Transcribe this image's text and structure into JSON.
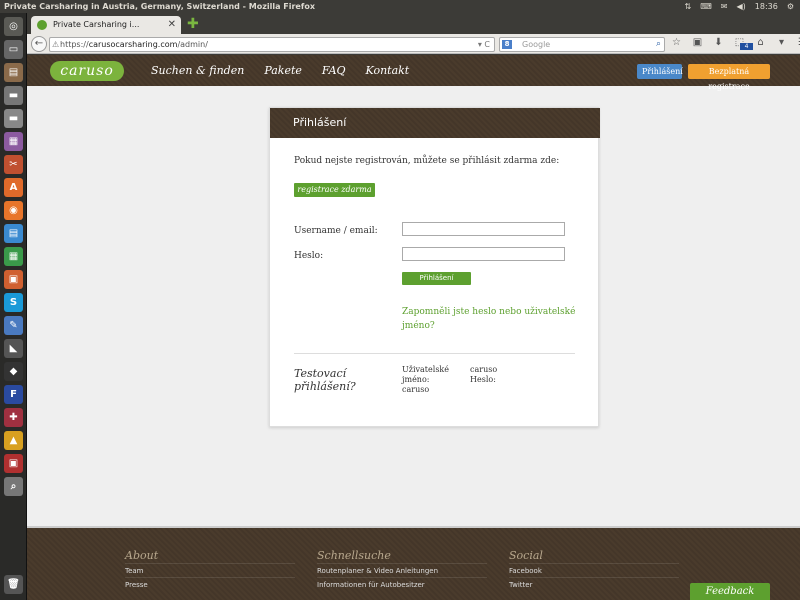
{
  "os": {
    "window_title": "Private Carsharing in Austria, Germany, Switzerland - Mozilla Firefox",
    "clock": "18:36"
  },
  "browser": {
    "tab_title": "Private Carsharing i...",
    "url_host": "carusocarsharing.com",
    "url_scheme": "https://",
    "url_path": "/admin/",
    "search_placeholder": "Google",
    "search_engine_label": "8",
    "badge_count": "4"
  },
  "site": {
    "logo_text": "caruso",
    "nav": [
      "Suchen & finden",
      "Pakete",
      "FAQ",
      "Kontakt"
    ],
    "login_button": "Přihlášení",
    "register_button": "Bezplatná registrace"
  },
  "login": {
    "title": "Přihlášení",
    "intro": "Pokud nejste registrován, můžete se přihlásit zdarma zde:",
    "register_free": "registrace zdarma →",
    "username_label": "Username / email:",
    "password_label": "Heslo:",
    "submit": "Přihlášení",
    "forgot": "Zapomněli jste heslo nebo uživatelské jméno?",
    "test_title": "Testovací přihlášení?",
    "test_user_label": "Uživatelské jméno:",
    "test_user_value": "caruso",
    "test_pass_label": "Heslo:",
    "test_pass_value": "caruso"
  },
  "footer": {
    "columns": [
      {
        "heading": "About",
        "links": [
          "Team",
          "Presse"
        ]
      },
      {
        "heading": "Schnellsuche",
        "links": [
          "Routenplaner & Video Anleitungen",
          "Informationen für Autobesitzer"
        ]
      },
      {
        "heading": "Social",
        "links": [
          "Facebook",
          "Twitter"
        ]
      }
    ],
    "feedback": "Feedback"
  },
  "colors": {
    "brand_green": "#5da02f",
    "header_brown": "#4a3b2c",
    "login_blue": "#4a88c9",
    "register_orange": "#f0a030"
  }
}
